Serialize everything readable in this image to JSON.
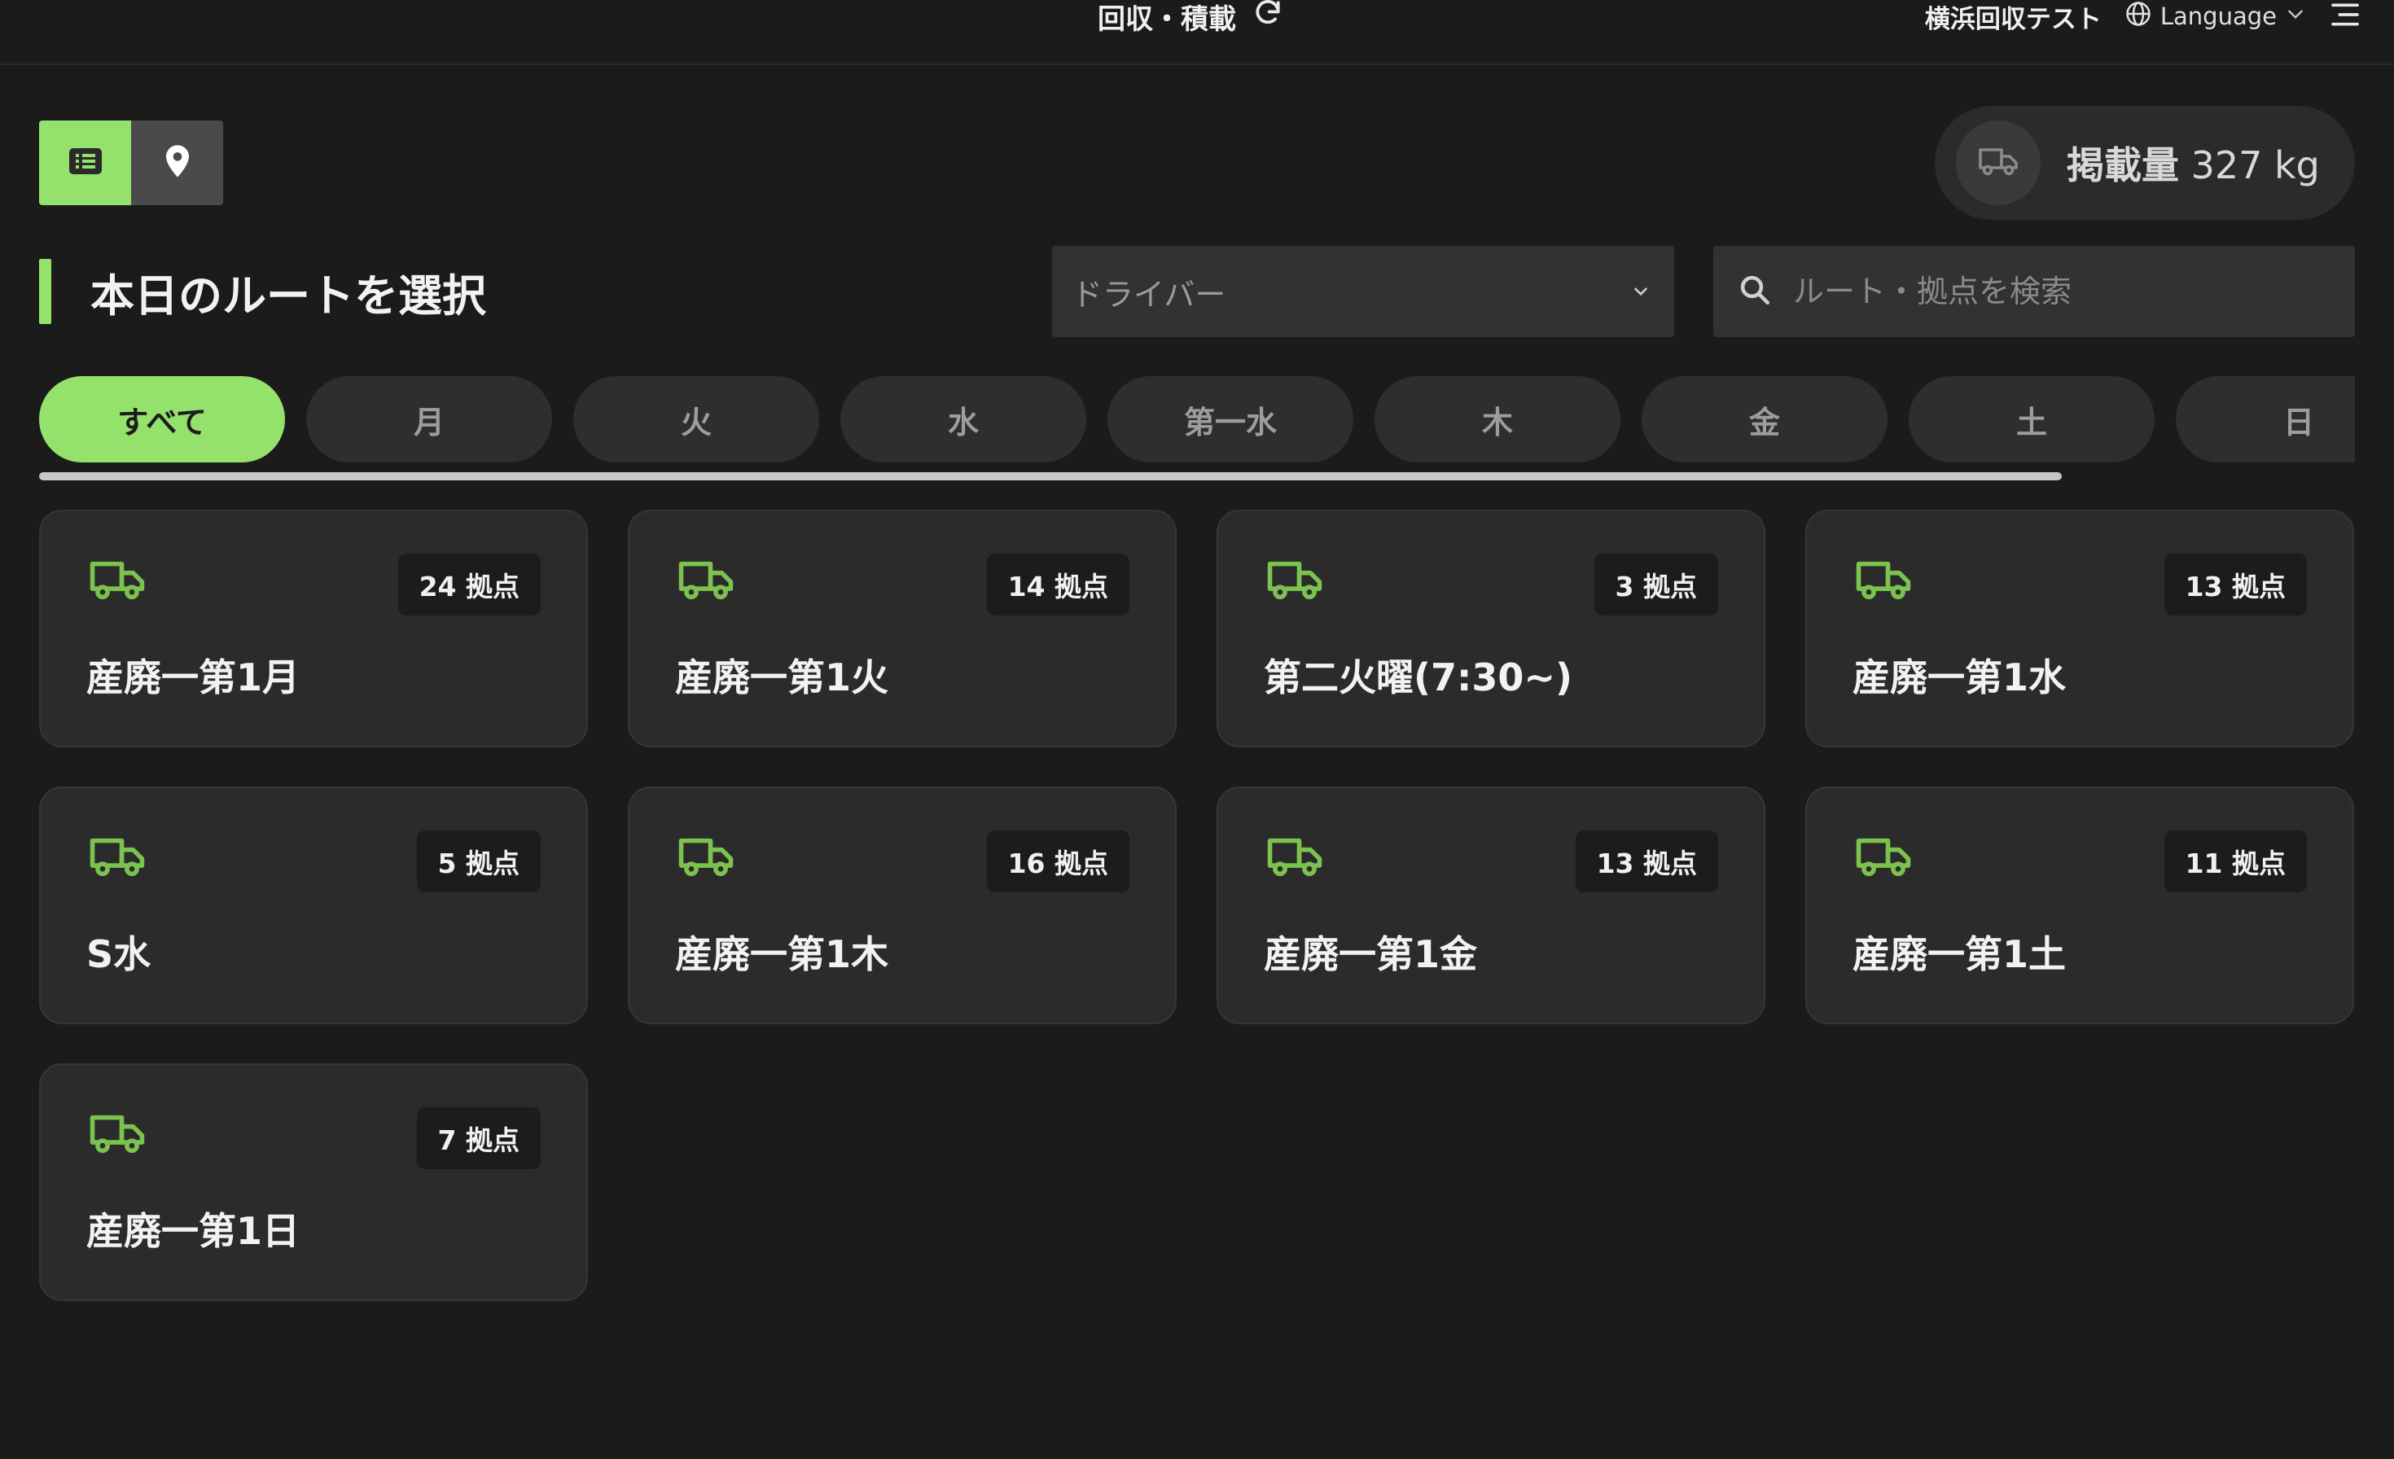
{
  "header": {
    "title": "回収・積載",
    "company": "横浜回収テスト",
    "language_label": "Language"
  },
  "load": {
    "label": "掲載量",
    "value": "327 kg"
  },
  "page": {
    "title": "本日のルートを選択"
  },
  "filters": {
    "driver_placeholder": "ドライバー",
    "search_placeholder": "ルート・拠点を検索"
  },
  "tabs": [
    {
      "label": "すべて",
      "active": true
    },
    {
      "label": "月"
    },
    {
      "label": "火"
    },
    {
      "label": "水"
    },
    {
      "label": "第一水"
    },
    {
      "label": "木"
    },
    {
      "label": "金"
    },
    {
      "label": "土"
    },
    {
      "label": "日"
    }
  ],
  "routes": [
    {
      "name": "産廃一第1月",
      "stops": "24 拠点"
    },
    {
      "name": "産廃一第1火",
      "stops": "14 拠点"
    },
    {
      "name": "第二火曜(7:30~)",
      "stops": "3 拠点"
    },
    {
      "name": "産廃一第1水",
      "stops": "13 拠点"
    },
    {
      "name": "S水",
      "stops": "5 拠点"
    },
    {
      "name": "産廃一第1木",
      "stops": "16 拠点"
    },
    {
      "name": "産廃一第1金",
      "stops": "13 拠点"
    },
    {
      "name": "産廃一第1土",
      "stops": "11 拠点"
    },
    {
      "name": "産廃一第1日",
      "stops": "7 拠点"
    }
  ],
  "colors": {
    "accent": "#94e26b",
    "truck_icon": "#7cc24f",
    "background": "#1b1b1b",
    "card": "#2b2b2b"
  },
  "icons": {
    "refresh": "refresh-icon",
    "globe": "globe-icon",
    "menu": "menu-icon",
    "list": "list-icon",
    "map_pin": "map-pin-icon",
    "truck": "truck-icon",
    "search": "search-icon",
    "chevron": "chevron-down-icon"
  }
}
